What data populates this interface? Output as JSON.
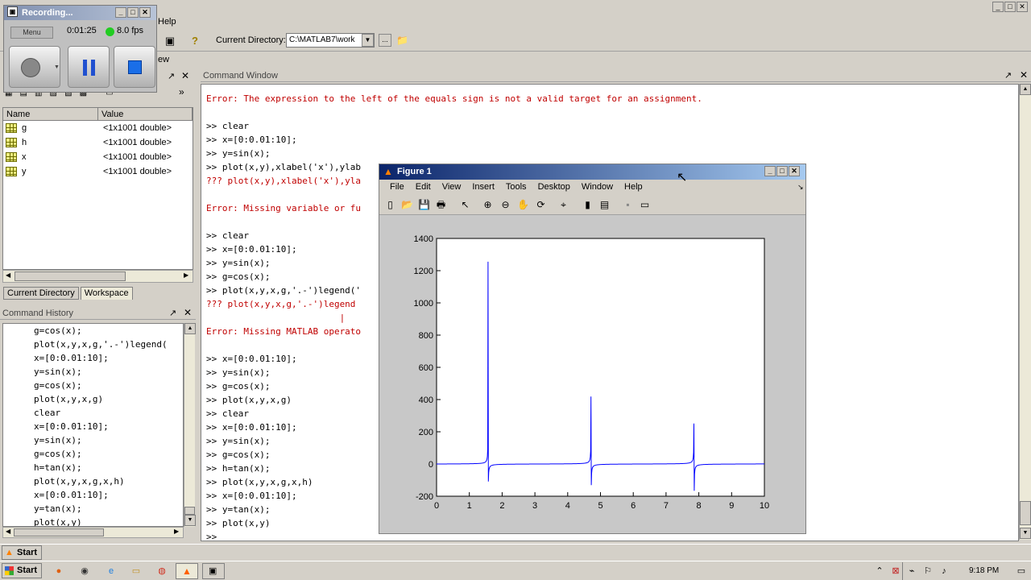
{
  "recorder": {
    "title": "Recording...",
    "menu_label": "Menu",
    "elapsed": "0:01:25",
    "fps": "8.0 fps"
  },
  "main_menu": {
    "help_fragment": "Help",
    "view_fragment": "ew"
  },
  "toolbar": {
    "current_dir_label": "Current Directory:",
    "current_dir_value": "C:\\MATLAB7\\work",
    "browse_label": "..."
  },
  "workspace": {
    "columns": [
      "Name",
      "Value"
    ],
    "rows": [
      {
        "name": "g",
        "value": "<1x1001 double>"
      },
      {
        "name": "h",
        "value": "<1x1001 double>"
      },
      {
        "name": "x",
        "value": "<1x1001 double>"
      },
      {
        "name": "y",
        "value": "<1x1001 double>"
      }
    ],
    "tabs": [
      "Current Directory",
      "Workspace"
    ]
  },
  "history": {
    "title": "Command History",
    "items": [
      "g=cos(x);",
      "plot(x,y,x,g,'.-')legend(",
      "x=[0:0.01:10];",
      "y=sin(x);",
      "g=cos(x);",
      "plot(x,y,x,g)",
      "clear",
      "x=[0:0.01:10];",
      "y=sin(x);",
      "g=cos(x);",
      "h=tan(x);",
      "plot(x,y,x,g,x,h)",
      "x=[0:0.01:10];",
      "y=tan(x);",
      "plot(x,y)"
    ]
  },
  "command_window": {
    "title": "Command Window",
    "lines": [
      {
        "t": "Error: The expression to the left of the equals sign is not a valid target for an assignment.",
        "err": true
      },
      {
        "t": "",
        "err": false
      },
      {
        "t": ">> clear",
        "err": false
      },
      {
        "t": ">> x=[0:0.01:10];",
        "err": false
      },
      {
        "t": ">> y=sin(x);",
        "err": false
      },
      {
        "t": ">> plot(x,y),xlabel('x'),ylab",
        "err": false
      },
      {
        "t": "??? plot(x,y),xlabel('x'),yla",
        "err": true
      },
      {
        "t": "",
        "err": false
      },
      {
        "t": "Error: Missing variable or fu",
        "err": true
      },
      {
        "t": "",
        "err": false
      },
      {
        "t": ">> clear",
        "err": false
      },
      {
        "t": ">> x=[0:0.01:10];",
        "err": false
      },
      {
        "t": ">> y=sin(x);",
        "err": false
      },
      {
        "t": ">> g=cos(x);",
        "err": false
      },
      {
        "t": ">> plot(x,y,x,g,'.-')legend('",
        "err": false
      },
      {
        "t": "??? plot(x,y,x,g,'.-')legend",
        "err": true
      },
      {
        "t": "                         |",
        "err": true
      },
      {
        "t": "Error: Missing MATLAB operato",
        "err": true
      },
      {
        "t": "",
        "err": false
      },
      {
        "t": ">> x=[0:0.01:10];",
        "err": false
      },
      {
        "t": ">> y=sin(x);",
        "err": false
      },
      {
        "t": ">> g=cos(x);",
        "err": false
      },
      {
        "t": ">> plot(x,y,x,g)",
        "err": false
      },
      {
        "t": ">> clear",
        "err": false
      },
      {
        "t": ">> x=[0:0.01:10];",
        "err": false
      },
      {
        "t": ">> y=sin(x);",
        "err": false
      },
      {
        "t": ">> g=cos(x);",
        "err": false
      },
      {
        "t": ">> h=tan(x);",
        "err": false
      },
      {
        "t": ">> plot(x,y,x,g,x,h)",
        "err": false
      },
      {
        "t": ">> x=[0:0.01:10];",
        "err": false
      },
      {
        "t": ">> y=tan(x);",
        "err": false
      },
      {
        "t": ">> plot(x,y)",
        "err": false
      },
      {
        "t": ">>",
        "err": false
      }
    ]
  },
  "figure": {
    "title": "Figure 1",
    "menu": [
      "File",
      "Edit",
      "View",
      "Insert",
      "Tools",
      "Desktop",
      "Window",
      "Help"
    ],
    "line_color": "#0000ff"
  },
  "chart_data": {
    "type": "line",
    "function": "tan",
    "x_range": [
      0,
      10
    ],
    "x_step": 0.01,
    "xlim": [
      0,
      10
    ],
    "ylim": [
      -200,
      1400
    ],
    "xticks": [
      0,
      1,
      2,
      3,
      4,
      5,
      6,
      7,
      8,
      9,
      10
    ],
    "yticks": [
      -200,
      0,
      200,
      400,
      600,
      800,
      1000,
      1200,
      1400
    ],
    "grid": false
  },
  "taskbar": {
    "start_label": "Start",
    "clock": "9:18 PM"
  }
}
